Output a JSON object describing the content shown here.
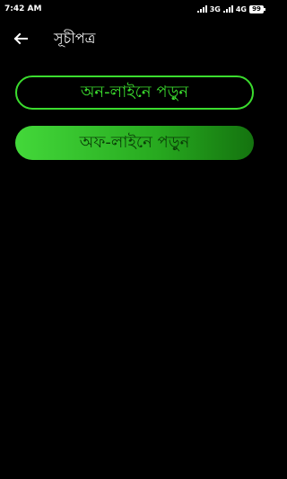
{
  "status_bar": {
    "time": "7:42 AM",
    "network_1": "3G",
    "network_2": "4G",
    "battery": "99"
  },
  "app_bar": {
    "title": "সূচীপত্র"
  },
  "buttons": {
    "online_label": "অন-লাইনে পড়ুন",
    "offline_label": "অফ-লাইনে পড়ুন"
  },
  "colors": {
    "background": "#000000",
    "accent_green": "#3bdc2e",
    "offline_gradient_start": "#43d83a",
    "offline_gradient_end": "#14730f"
  },
  "icons": {
    "back": "arrow-left-icon"
  }
}
